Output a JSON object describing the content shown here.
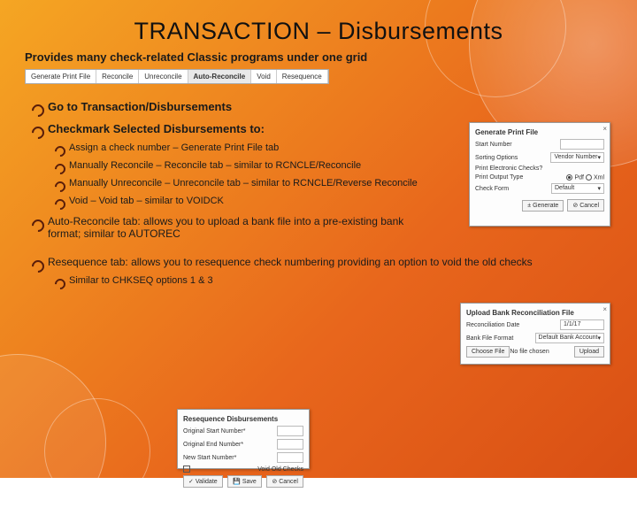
{
  "title": "TRANSACTION – Disbursements",
  "subtitle": "Provides many check-related Classic programs under one grid",
  "tabs": [
    "Generate Print File",
    "Reconcile",
    "Unreconcile",
    "Auto-Reconcile",
    "Void",
    "Resequence"
  ],
  "body": {
    "l1": "Go to Transaction/Disbursements",
    "l2": "Checkmark Selected Disbursements to:",
    "s1": "Assign a check number – Generate Print File tab",
    "s2": "Manually Reconcile – Reconcile tab – similar to RCNCLE/Reconcile",
    "s3": "Manually Unreconcile – Unreconcile tab – similar to RCNCLE/Reverse Reconcile",
    "s4": "Void – Void tab – similar to VOIDCK",
    "l3": "Auto-Reconcile tab: allows you to upload a bank file into a pre-existing bank format; similar to AUTOREC",
    "l4": "Resequence tab: allows you to resequence check numbering providing an option to void the old checks",
    "s5": "Similar to CHKSEQ options 1 & 3"
  },
  "panel1": {
    "title": "Generate Print File",
    "r1": "Start Number",
    "r2": "Sorting Options",
    "r2v": "Vendor Number",
    "r3": "Print Electronic Checks?",
    "r4": "Print Output Type",
    "r4a": "Pdf",
    "r4b": "Xml",
    "r5": "Check Form",
    "r5v": "Default",
    "b1": "Generate",
    "b2": "Cancel"
  },
  "panel2": {
    "title": "Upload Bank Reconciliation File",
    "r1": "Reconciliation Date",
    "r1v": "1/1/17",
    "r2": "Bank File Format",
    "r2v": "Default Bank Account",
    "b1": "Choose File",
    "b1v": "No file chosen",
    "b2": "Upload"
  },
  "panel3": {
    "title": "Resequence Disbursements",
    "r1": "Original Start Number*",
    "r2": "Original End Number*",
    "r3": "New Start Number*",
    "c1": "Void Old Checks",
    "b1": "Validate",
    "b2": "Save",
    "b3": "Cancel"
  }
}
